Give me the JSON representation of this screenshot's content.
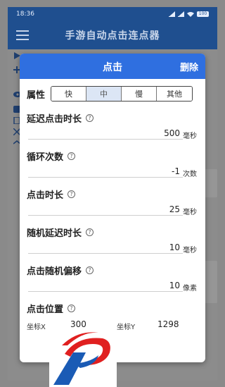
{
  "status": {
    "time": "18:36",
    "battery": "100"
  },
  "app": {
    "title": "手游自动点击连点器"
  },
  "dialog": {
    "title": "点击",
    "delete_label": "删除",
    "attribute": {
      "label": "属性",
      "options": [
        "快",
        "中",
        "慢",
        "其他"
      ],
      "selected": "中"
    },
    "fields": [
      {
        "label": "延迟点击时长",
        "value": "500",
        "unit": "毫秒"
      },
      {
        "label": "循环次数",
        "value": "-1",
        "unit": "次数"
      },
      {
        "label": "点击时长",
        "value": "25",
        "unit": "毫秒"
      },
      {
        "label": "随机延迟时长",
        "value": "10",
        "unit": "毫秒"
      },
      {
        "label": "点击随机偏移",
        "value": "10",
        "unit": "像素"
      }
    ],
    "position": {
      "label": "点击位置",
      "x_label": "坐标X",
      "x_value": "300",
      "y_label": "坐标Y",
      "y_value": "1298"
    }
  },
  "colors": {
    "primary": "#2f6fe0",
    "toolbar": "#1f4f8f",
    "logo_red": "#e02020",
    "logo_blue": "#1a5bb5"
  }
}
